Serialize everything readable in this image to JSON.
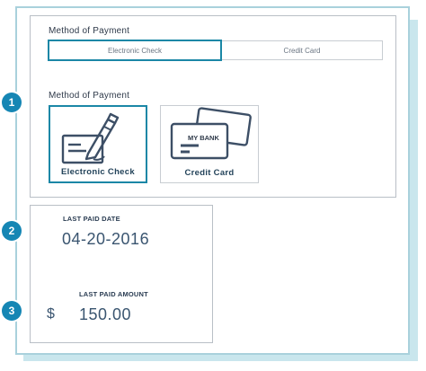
{
  "payment_selector": {
    "title": "Method of Payment",
    "options": [
      "Electronic Check",
      "Credit Card"
    ],
    "selected": "Electronic Check"
  },
  "payment_tiles": {
    "title": "Method of Payment",
    "tiles": [
      {
        "label": "Electronic Check",
        "icon": "check-pen-icon",
        "selected": true
      },
      {
        "label": "Credit Card",
        "icon": "credit-card-icon",
        "card_text": "MY BANK",
        "selected": false
      }
    ]
  },
  "last_paid": {
    "date_label": "LAST PAID DATE",
    "date_value": "04-20-2016",
    "amount_label": "LAST PAID AMOUNT",
    "currency_symbol": "$",
    "amount_value": "150.00"
  },
  "callouts": [
    "1",
    "2",
    "3"
  ],
  "colors": {
    "accent": "#1b87a6",
    "badge": "#1586b4",
    "frame_shadow": "#c9e6ed",
    "frame_border": "#a9d1dc",
    "icon_stroke": "#3d4f66"
  }
}
